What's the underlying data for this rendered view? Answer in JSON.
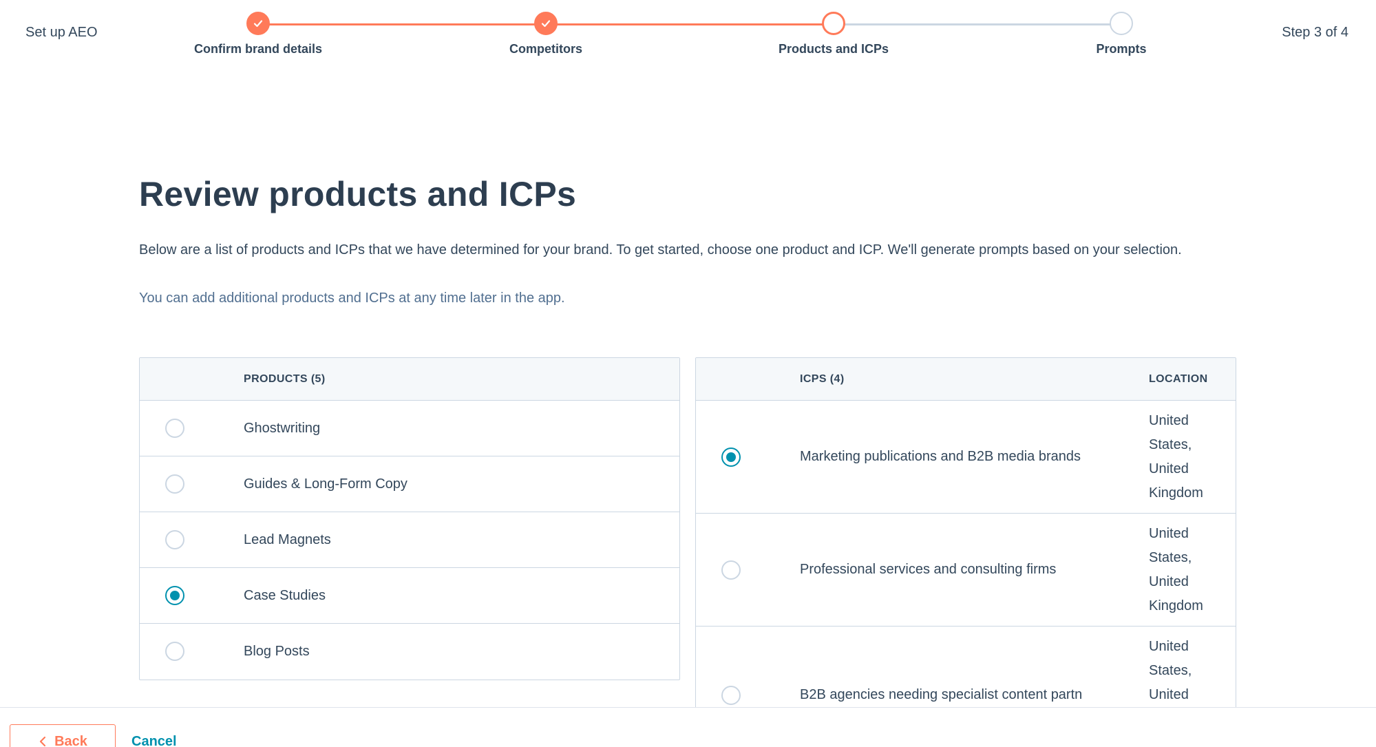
{
  "header": {
    "app_title": "Set up AEO",
    "step_count": "Step 3 of 4",
    "steps": [
      {
        "label": "Confirm brand details",
        "status": "complete"
      },
      {
        "label": "Competitors",
        "status": "complete"
      },
      {
        "label": "Products and ICPs",
        "status": "current"
      },
      {
        "label": "Prompts",
        "status": "upcoming"
      }
    ]
  },
  "main": {
    "title": "Review products and ICPs",
    "intro": "Below are a list of products and ICPs that we have determined for your brand. To get started, choose one product and ICP. We'll generate prompts based on your selection.",
    "hint": "You can add additional products and ICPs at any time later in the app."
  },
  "products": {
    "header": "PRODUCTS (5)",
    "items": [
      {
        "label": "Ghostwriting",
        "selected": false
      },
      {
        "label": "Guides & Long-Form Copy",
        "selected": false
      },
      {
        "label": "Lead Magnets",
        "selected": false
      },
      {
        "label": "Case Studies",
        "selected": true
      },
      {
        "label": "Blog Posts",
        "selected": false
      }
    ]
  },
  "icps": {
    "header": "ICPS (4)",
    "location_header": "LOCATION",
    "items": [
      {
        "label": "Marketing publications and B2B media brands",
        "location": "United States, United Kingdom",
        "selected": true
      },
      {
        "label": "Professional services and consulting firms",
        "location": "United States, United Kingdom",
        "selected": false
      },
      {
        "label": "B2B agencies needing specialist content partn",
        "location": "United States, United",
        "selected": false
      }
    ]
  },
  "footer": {
    "back_label": "Back",
    "cancel_label": "Cancel"
  },
  "colors": {
    "accent": "#ff7a59",
    "radio_selected": "#0091ae",
    "text": "#33475b"
  }
}
